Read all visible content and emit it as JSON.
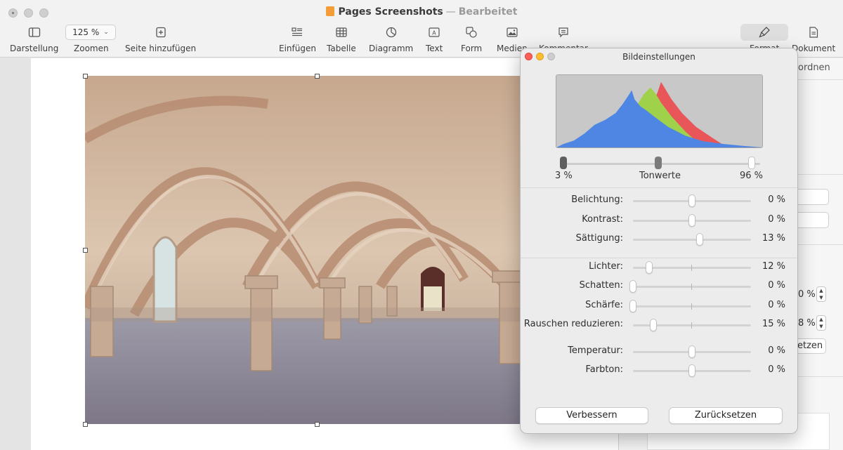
{
  "window": {
    "app_name": "Pages Screenshots",
    "separator": "—",
    "status": "Bearbeitet"
  },
  "toolbar": {
    "items": [
      {
        "label": "Darstellung",
        "icon": "sidebar-icon"
      },
      {
        "label": "Zoomen",
        "icon": "zoom-icon",
        "value": "125 %"
      },
      {
        "label": "Seite hinzufügen",
        "icon": "add-page-icon"
      },
      {
        "label": "Einfügen",
        "icon": "insert-icon"
      },
      {
        "label": "Tabelle",
        "icon": "table-icon"
      },
      {
        "label": "Diagramm",
        "icon": "chart-icon"
      },
      {
        "label": "Text",
        "icon": "textbox-icon"
      },
      {
        "label": "Form",
        "icon": "shape-icon"
      },
      {
        "label": "Medien",
        "icon": "media-icon"
      },
      {
        "label": "Kommentar",
        "icon": "comment-icon"
      },
      {
        "label": "Format",
        "icon": "paintbrush-icon"
      },
      {
        "label": "Dokument",
        "icon": "document-icon"
      }
    ]
  },
  "sidebar": {
    "tab_partial": "ordnen",
    "value_1": "0 %",
    "value_2": "8 %",
    "button_partial": "etzen"
  },
  "panel": {
    "title": "Bildeinstellungen",
    "levels": {
      "low": "3 %",
      "label": "Tonwerte",
      "high": "96 %"
    },
    "adjustments": [
      {
        "label": "Belichtung:",
        "value": "0 %",
        "level": 0
      },
      {
        "label": "Kontrast:",
        "value": "0 %",
        "level": 0
      },
      {
        "label": "Sättigung:",
        "value": "13 %",
        "level": 13
      },
      {
        "label": "Lichter:",
        "value": "12 %",
        "level": 12
      },
      {
        "label": "Schatten:",
        "value": "0 %",
        "level": 0
      },
      {
        "label": "Schärfe:",
        "value": "0 %",
        "level": 0
      },
      {
        "label": "Rauschen reduzieren:",
        "value": "15 %",
        "level": 15
      },
      {
        "label": "Temperatur:",
        "value": "0 %",
        "level": 0
      },
      {
        "label": "Farbton:",
        "value": "0 %",
        "level": 0
      }
    ],
    "buttons": {
      "enhance": "Verbessern",
      "reset": "Zurücksetzen"
    }
  },
  "colors": {
    "histogram_blue": "#4f86e4",
    "histogram_green": "#9fd24a",
    "histogram_red": "#e8565a",
    "close": "#fe5f57",
    "minimize": "#febc2e"
  }
}
